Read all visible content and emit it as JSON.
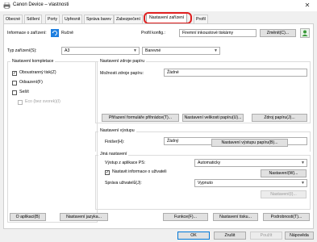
{
  "window": {
    "title": "Canon Device – vlastnosti",
    "close_glyph": "✕"
  },
  "tabs": [
    {
      "label": "Obecné",
      "active": false
    },
    {
      "label": "Sdílení",
      "active": false
    },
    {
      "label": "Porty",
      "active": false
    },
    {
      "label": "Upřesnit",
      "active": false
    },
    {
      "label": "Správa barev",
      "active": false
    },
    {
      "label": "Zabezpečení",
      "active": false
    },
    {
      "label": "Nastavení zařízení",
      "active": true
    },
    {
      "label": "Profil",
      "active": false
    }
  ],
  "device_info": {
    "label": "Informace o zařízení:",
    "mode": "Ručně"
  },
  "profile": {
    "label": "Profil konfig.:",
    "value": "Firemní inkoustové tiskárny",
    "change_button": "Změnit(C)..."
  },
  "device_type": {
    "label": "Typ zařízení(S):",
    "size": "A3",
    "color": "Barevné"
  },
  "options": {
    "title": "Nastavení kompletace",
    "duplex": {
      "label": "Oboustranný tisk(Z)",
      "checked": true
    },
    "offset": {
      "label": "Odsazení(F)",
      "checked": false
    },
    "staple": {
      "label": "Sešít",
      "checked": false
    },
    "staple_free": {
      "label": "Eco (bez svorek)(I)",
      "checked": false
    }
  },
  "paper_source": {
    "title": "Nastavení zdroje papíru",
    "options_label": "Možnosti zdroje papíru:",
    "options_value": "Žádné",
    "btn_assign": "Přiřazení formuláře přihrádce(T)...",
    "btn_size": "Nastavení velikosti papíru(U)...",
    "btn_source": "Zdroj papíru(J)..."
  },
  "output": {
    "title": "Nastavení výstupu",
    "finisher_label": "Finišer(H):",
    "finisher_value": "Žádný",
    "btn_settings": "Nastavení výstupu papíru(B)..."
  },
  "other": {
    "title": "Jiná nastavení",
    "ps_label": "Výstup z aplikace PS:",
    "ps_value": "Automaticky",
    "user_info_label": "Nastavit informace o uživateli",
    "user_info_checked": true,
    "btn_user_settings": "Nastavení(W)...",
    "user_mgmt_label": "Správa uživatelů(J):",
    "user_mgmt_value": "Vypnuto",
    "btn_user_mgmt_settings": "Nastavení(I)..."
  },
  "bottom": {
    "about": "O aplikaci(B)",
    "lang": "Nastavení jazyka...",
    "function": "Funkce(F)...",
    "print_settings": "Nastavení tisku...",
    "details": "Podrobnosti(T)..."
  },
  "dialog": {
    "ok": "OK",
    "cancel": "Zrušit",
    "apply": "Použít",
    "help": "Nápověda"
  },
  "colors": {
    "accent": "#0078d7",
    "ring": "#e02020"
  }
}
